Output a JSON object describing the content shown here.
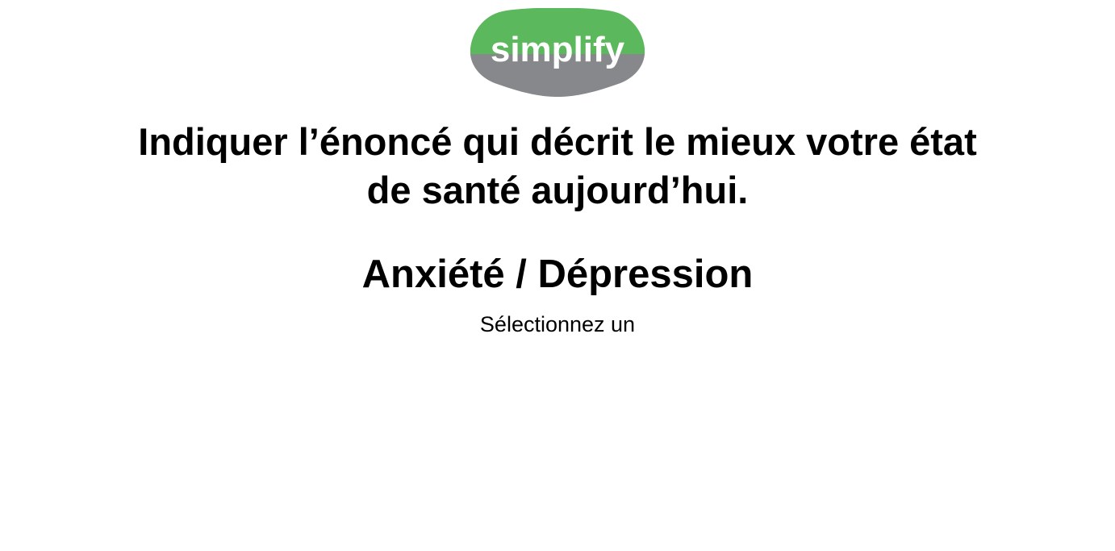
{
  "logo": {
    "text": "simplify",
    "top_color": "#5cb85c",
    "bottom_color": "#87888b",
    "text_color": "#ffffff"
  },
  "question": {
    "line1": "Indiquer l’énoncé qui décrit le mieux votre état",
    "line2": "de santé aujourd’hui."
  },
  "dimension": {
    "title": "Anxiété / Dépression"
  },
  "instruction": {
    "text": "Sélectionnez un"
  }
}
